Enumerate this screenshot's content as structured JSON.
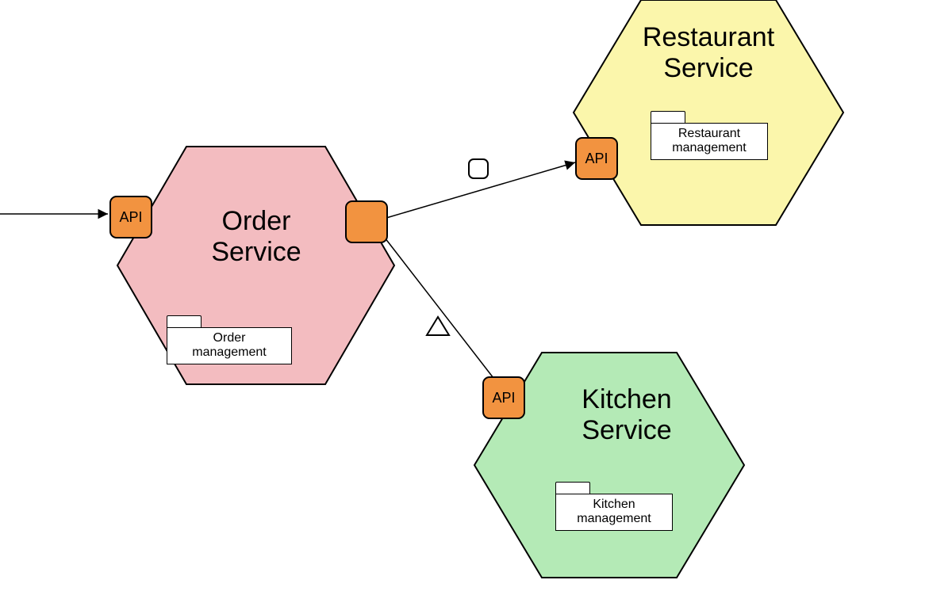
{
  "services": {
    "order": {
      "title_line1": "Order",
      "title_line2": "Service",
      "api_label": "API",
      "module_line1": "Order",
      "module_line2": "management",
      "fill": "#f3bcc0"
    },
    "restaurant": {
      "title_line1": "Restaurant",
      "title_line2": "Service",
      "api_label": "API",
      "module_line1": "Restaurant",
      "module_line2": "management",
      "fill": "#fbf6ab"
    },
    "kitchen": {
      "title_line1": "Kitchen",
      "title_line2": "Service",
      "api_label": "API",
      "module_line1": "Kitchen",
      "module_line2": "management",
      "fill": "#b4eab6"
    }
  },
  "colors": {
    "port": "#f29340",
    "stroke": "#000000"
  }
}
